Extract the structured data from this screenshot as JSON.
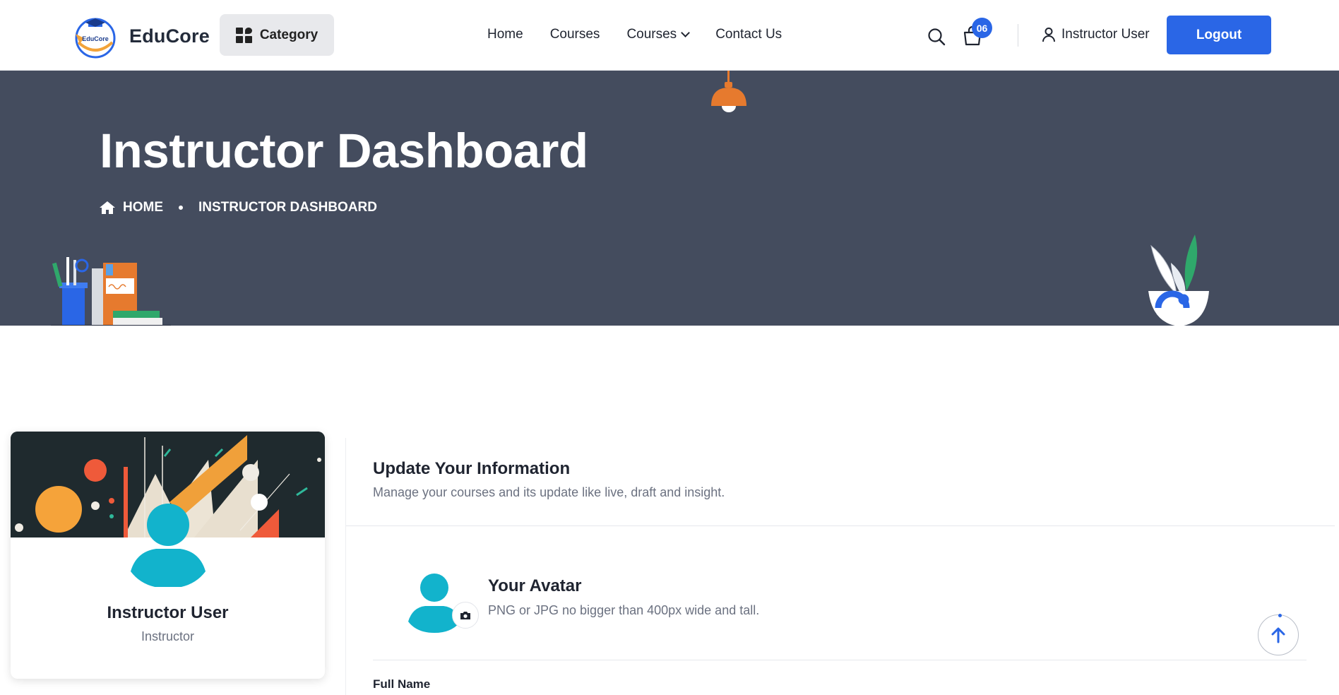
{
  "header": {
    "logo_text": "EduCore",
    "logo_badge_text": "EduCore",
    "category_label": "Category",
    "nav": [
      {
        "label": "Home"
      },
      {
        "label": "Courses"
      },
      {
        "label": "Courses",
        "has_dropdown": true
      },
      {
        "label": "Contact Us"
      }
    ],
    "cart_count": "06",
    "user_label": "Instructor User",
    "logout_label": "Logout",
    "icons": [
      "search-icon",
      "cart-icon",
      "user-icon",
      "grid-icon",
      "chevron-down-icon"
    ]
  },
  "hero": {
    "title": "Instructor Dashboard",
    "breadcrumb": [
      {
        "label": "HOME",
        "icon": "home-icon"
      },
      {
        "label": "INSTRUCTOR DASHBOARD"
      }
    ]
  },
  "profile": {
    "name": "Instructor User",
    "role": "Instructor"
  },
  "panel": {
    "title": "Update Your Information",
    "subtitle": "Manage your courses and its update like live, draft and insight.",
    "avatar_title": "Your Avatar",
    "avatar_hint": "PNG or JPG no bigger than 400px wide and tall.",
    "full_name_label": "Full Name"
  },
  "colors": {
    "accent": "#2a66e6",
    "hero_bg": "#444c5e",
    "avatar": "#12b3cc"
  }
}
